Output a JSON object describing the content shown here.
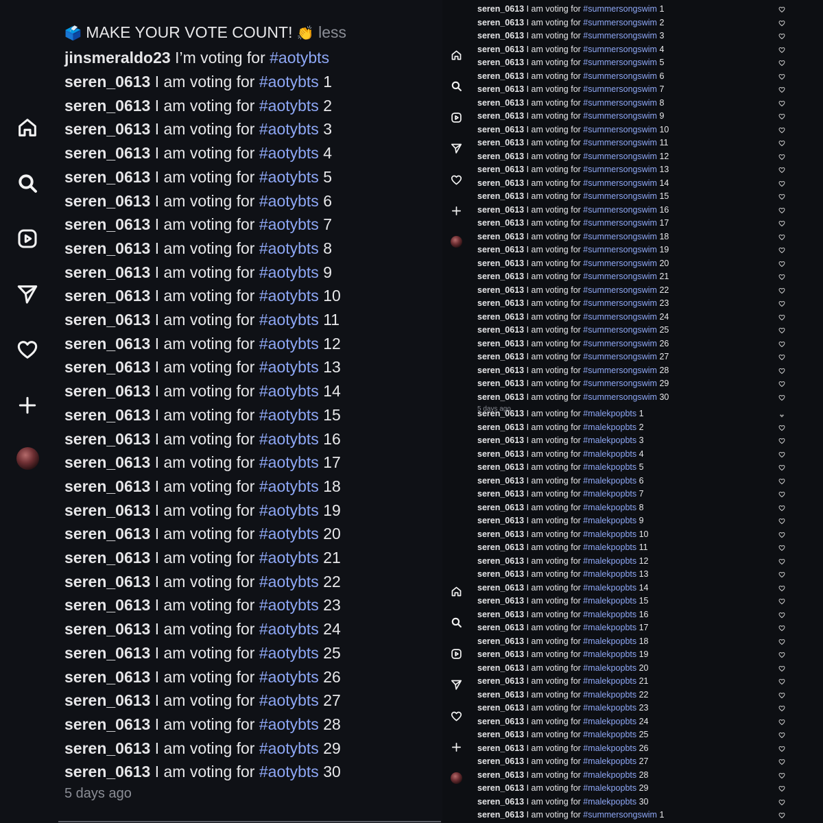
{
  "left": {
    "caption": {
      "emoji": "🗳️",
      "text": "MAKE YOUR VOTE COUNT!",
      "emoji2": "👏",
      "less": "less"
    },
    "first_comment": {
      "user": "jinsmeraldo23",
      "text": "I’m voting for",
      "tag": "#aotybts"
    },
    "comments": {
      "user": "seren_0613",
      "text": "I am voting for",
      "tag": "#aotybts",
      "numbers": [
        "1",
        "2",
        "3",
        "4",
        "5",
        "6",
        "7",
        "8",
        "9",
        "10",
        "11",
        "12",
        "13",
        "14",
        "15",
        "16",
        "17",
        "18",
        "19",
        "20",
        "21",
        "22",
        "23",
        "24",
        "25",
        "26",
        "27",
        "28",
        "29",
        "30"
      ]
    },
    "timestamp": "5 days ago",
    "nav_icons": [
      "home-icon",
      "search-icon",
      "reels-icon",
      "send-icon",
      "heart-icon",
      "plus-icon",
      "avatar"
    ]
  },
  "right": {
    "group1": {
      "user": "seren_0613",
      "text": "I am voting for",
      "tag": "#summersongswim",
      "numbers": [
        "1",
        " 2",
        "3",
        "4",
        "5",
        "6",
        "7",
        "8",
        "9",
        "10",
        "11",
        "12",
        "13",
        "14",
        "15",
        "16",
        "17",
        "18",
        "19",
        "20",
        "21",
        "22",
        "23",
        "24",
        "25",
        "26",
        "27",
        "28",
        "29",
        "30"
      ]
    },
    "timestamp": "5 days ago",
    "group2": {
      "user": "seren_0613",
      "text": "I am voting for",
      "tag": "#malekpopbts",
      "numbers": [
        "1",
        "2",
        "3",
        "4",
        "5",
        "6",
        "7",
        "8",
        "9",
        "10",
        "11",
        "12",
        "13",
        "14",
        "15",
        "16",
        "17",
        "18",
        "19",
        "20",
        "21",
        "22",
        "23",
        "24",
        "25",
        "26",
        "27",
        "28",
        "29",
        "30"
      ]
    },
    "last_line": {
      "user": "seren_0613",
      "text": "I am voting for",
      "tag": "#summersongswim",
      "number": "1"
    },
    "nav_icons": [
      "home-icon",
      "search-icon",
      "reels-icon",
      "send-icon",
      "heart-icon",
      "plus-icon",
      "avatar"
    ]
  }
}
